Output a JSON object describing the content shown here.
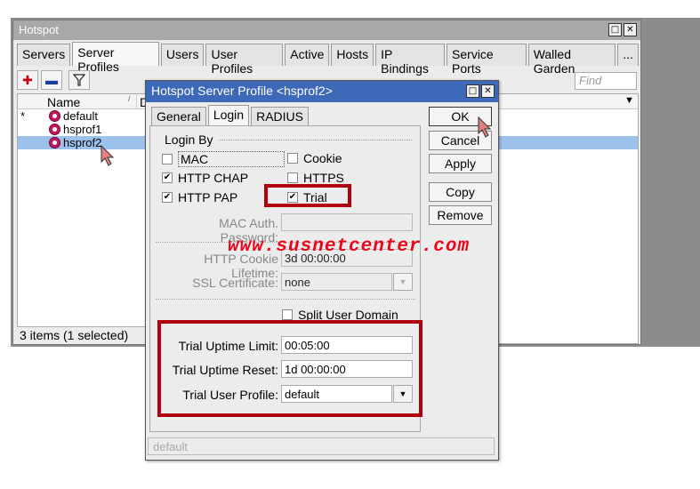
{
  "main_window": {
    "title": "Hotspot",
    "tabs": [
      "Servers",
      "Server Profiles",
      "Users",
      "User Profiles",
      "Active",
      "Hosts",
      "IP Bindings",
      "Service Ports",
      "Walled Garden",
      "..."
    ],
    "toolbar": {
      "add_icon": "plus-icon",
      "remove_icon": "minus-icon",
      "filter_icon": "filter-icon",
      "find_placeholder": "Find"
    },
    "list": {
      "col_name": "Name",
      "col_d": "D",
      "rows": [
        {
          "flag": "*",
          "name": "default"
        },
        {
          "flag": "",
          "name": "hsprof1"
        },
        {
          "flag": "",
          "name": "hsprof2"
        }
      ]
    },
    "status": "3 items (1 selected)"
  },
  "dialog": {
    "title": "Hotspot Server Profile <hsprof2>",
    "tabs": [
      "General",
      "Login",
      "RADIUS"
    ],
    "login_by_label": "Login By",
    "checks": {
      "mac": {
        "label": "MAC",
        "checked": ""
      },
      "cookie": {
        "label": "Cookie",
        "checked": ""
      },
      "http_chap": {
        "label": "HTTP CHAP",
        "checked": "✔"
      },
      "https": {
        "label": "HTTPS",
        "checked": ""
      },
      "http_pap": {
        "label": "HTTP PAP",
        "checked": "✔"
      },
      "trial": {
        "label": "Trial",
        "checked": "✔"
      },
      "split_user_domain": {
        "label": "Split User Domain",
        "checked": ""
      }
    },
    "mac_auth_password_label": "MAC Auth. Password:",
    "mac_auth_password_value": "",
    "http_cookie_lifetime_label": "HTTP Cookie Lifetime:",
    "http_cookie_lifetime_value": "3d 00:00:00",
    "ssl_certificate_label": "SSL Certificate:",
    "ssl_certificate_value": "none",
    "trial_uptime_limit_label": "Trial Uptime Limit:",
    "trial_uptime_limit_value": "00:05:00",
    "trial_uptime_reset_label": "Trial Uptime Reset:",
    "trial_uptime_reset_value": "1d 00:00:00",
    "trial_user_profile_label": "Trial User Profile:",
    "trial_user_profile_value": "default",
    "buttons": {
      "ok": "OK",
      "cancel": "Cancel",
      "apply": "Apply",
      "copy": "Copy",
      "remove": "Remove"
    },
    "status": "default"
  },
  "watermark": "www.susnetcenter.com",
  "colors": {
    "dialog_titlebar": "#3e69b8",
    "highlight_box": "#b00010",
    "watermark": "#e8081a",
    "selected_row": "#9cc2ec"
  }
}
